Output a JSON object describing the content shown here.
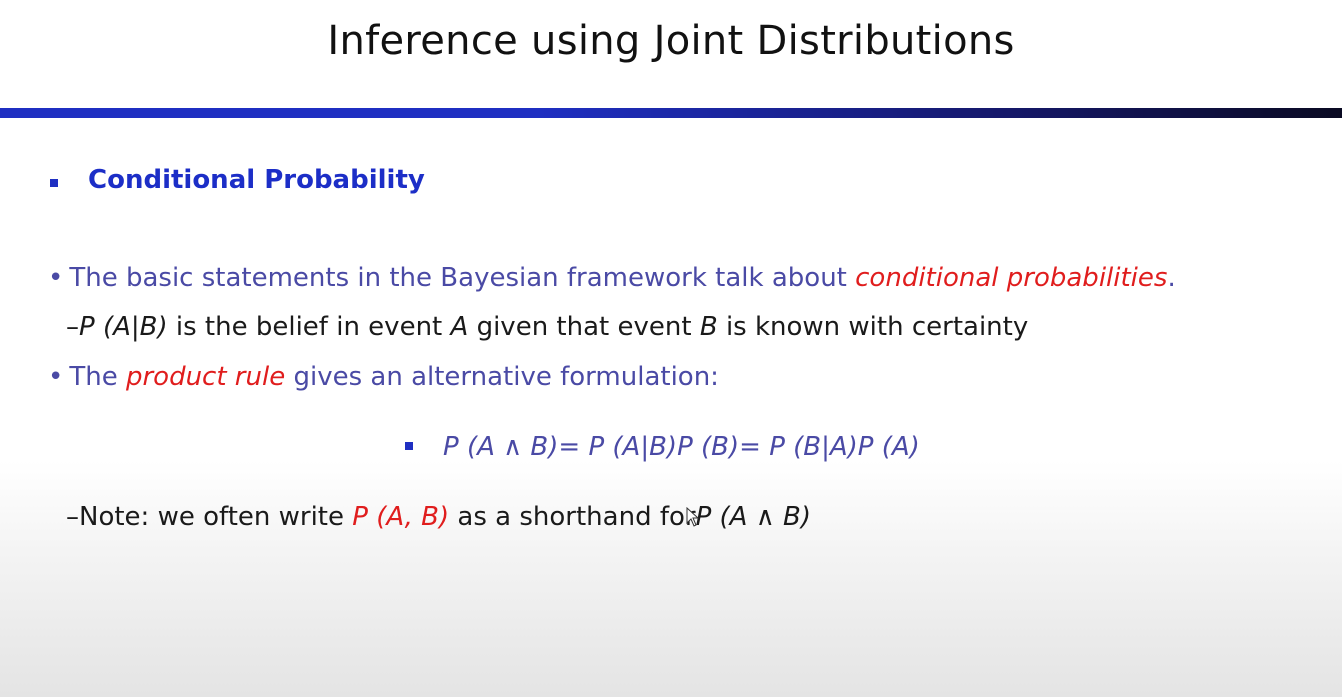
{
  "slide": {
    "title": "Inference using Joint Distributions",
    "heading": "Conditional Probability",
    "bullet1": {
      "marker": "•",
      "text_a": "The basic statements in the Bayesian framework talk about",
      "emphasis": "conditional  probabilities",
      "text_b": "."
    },
    "sub1": {
      "dash": "–",
      "expr": "P (A|B)",
      "text_a": "is the belief in event",
      "var_a": "A",
      "text_b": "given that event",
      "var_b": "B",
      "text_c": "is known with certainty"
    },
    "bullet2": {
      "marker": "•",
      "text_a": "The",
      "emphasis": "product rule",
      "text_b": "gives an alternative formulation:"
    },
    "formula": "P (A ∧ B)= P (A|B)P (B)= P (B|A)P (A)",
    "note": {
      "text_a": "–Note: we often write",
      "expr_red": "P (A, B)",
      "text_b": "as a shorthand for",
      "expr": "P (A ∧ B)"
    }
  },
  "colors": {
    "title_rule": "#1f2fc2",
    "heading": "#1c2ec7",
    "body_blue": "#4a4aa5",
    "emphasis_red": "#e01d1d"
  },
  "icons": {
    "pointer": "mouse-cursor-icon"
  }
}
